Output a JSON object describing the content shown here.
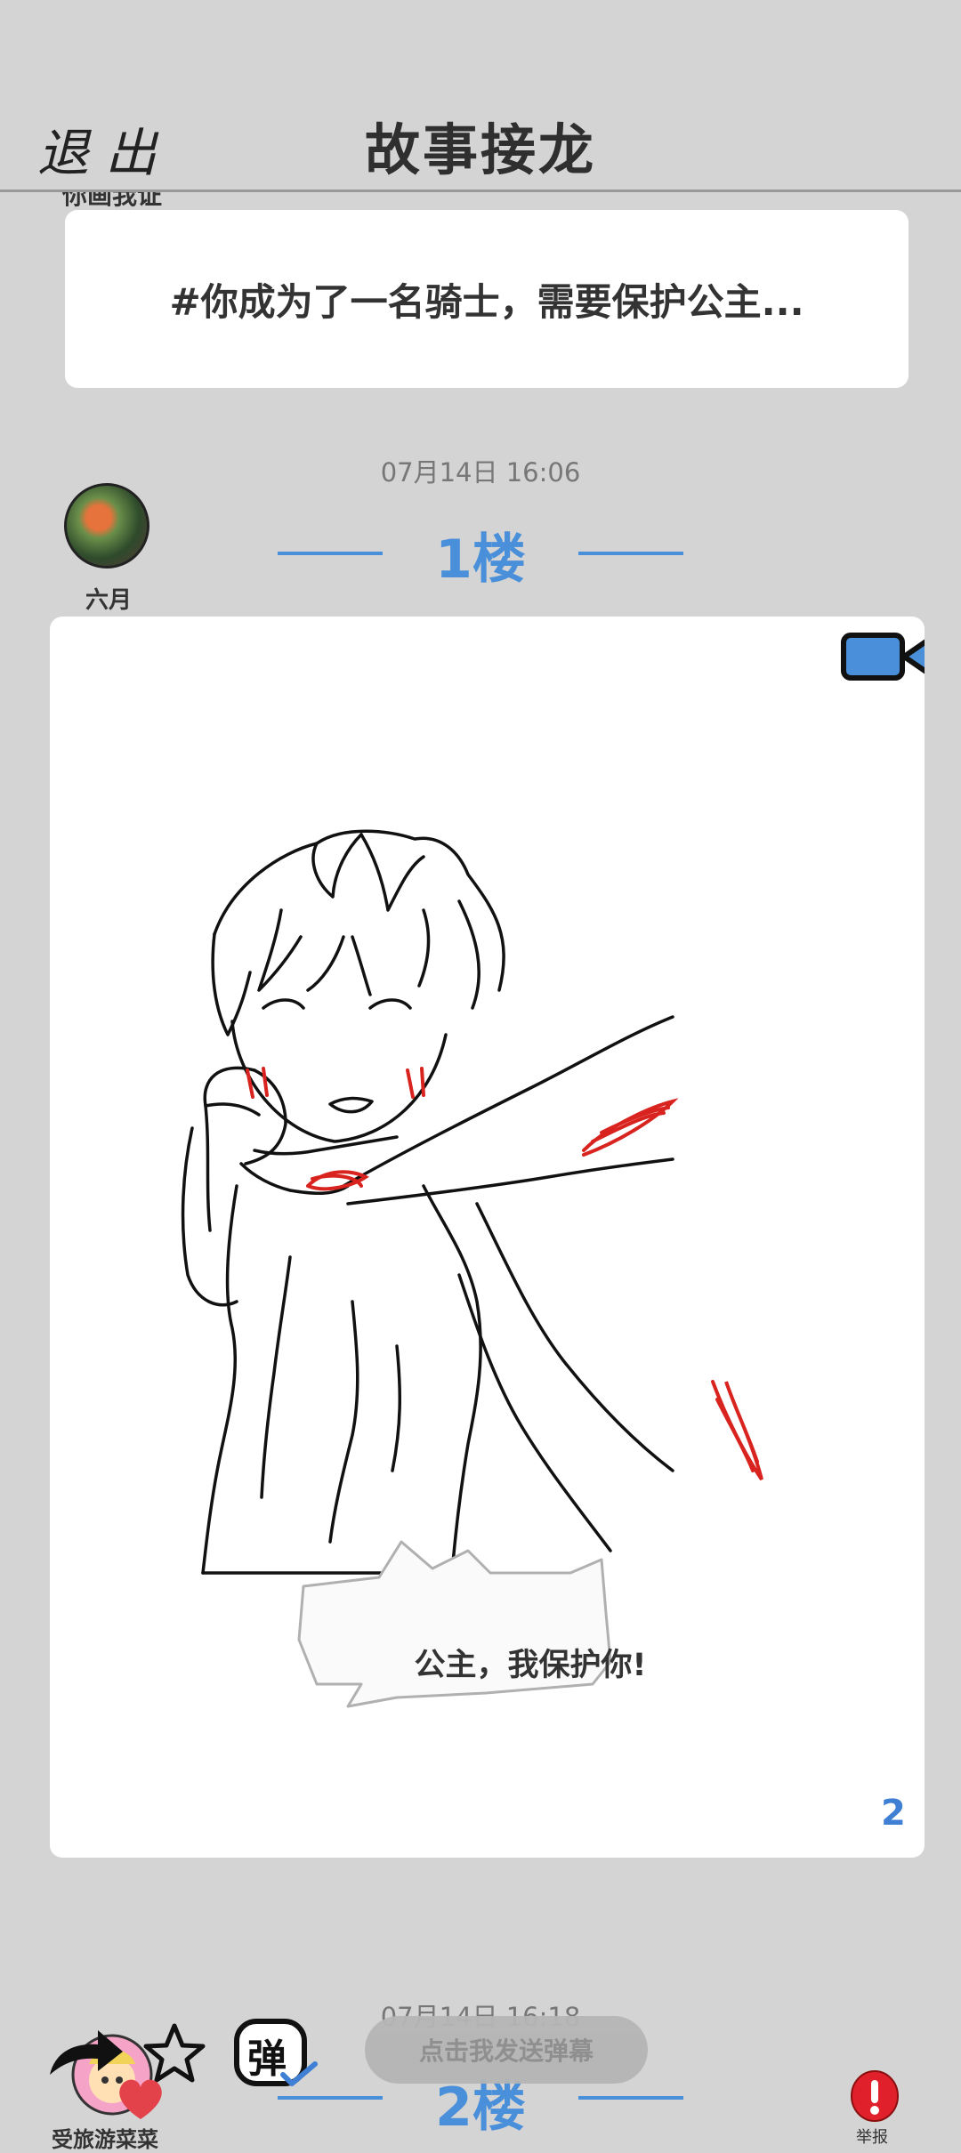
{
  "header": {
    "exit_label": "退出",
    "title": "故事接龙"
  },
  "topic": {
    "label_peek": "你画我证",
    "text": "#你成为了一名骑士，需要保护公主..."
  },
  "floors": [
    {
      "timestamp": "07月14日  16:06",
      "floor_label": "1楼",
      "author": "六月",
      "bubble_text": "公主，我保护你!",
      "page_number": "2"
    },
    {
      "timestamp": "07月14日  16:18",
      "floor_label": "2楼",
      "author": "受旅游菜菜"
    }
  ],
  "toolbar": {
    "danmaku_placeholder": "点击我发送弹幕",
    "danmaku_toggle_glyph": "弹",
    "report_label": "举报"
  },
  "colors": {
    "accent": "#4a8fd9",
    "background": "#d4d4d4",
    "card": "#ffffff",
    "report": "#e0202a"
  },
  "icons": [
    "video-camera-icon",
    "share-arrow-icon",
    "star-icon",
    "danmaku-toggle-icon",
    "report-icon",
    "like-heart-icon"
  ]
}
